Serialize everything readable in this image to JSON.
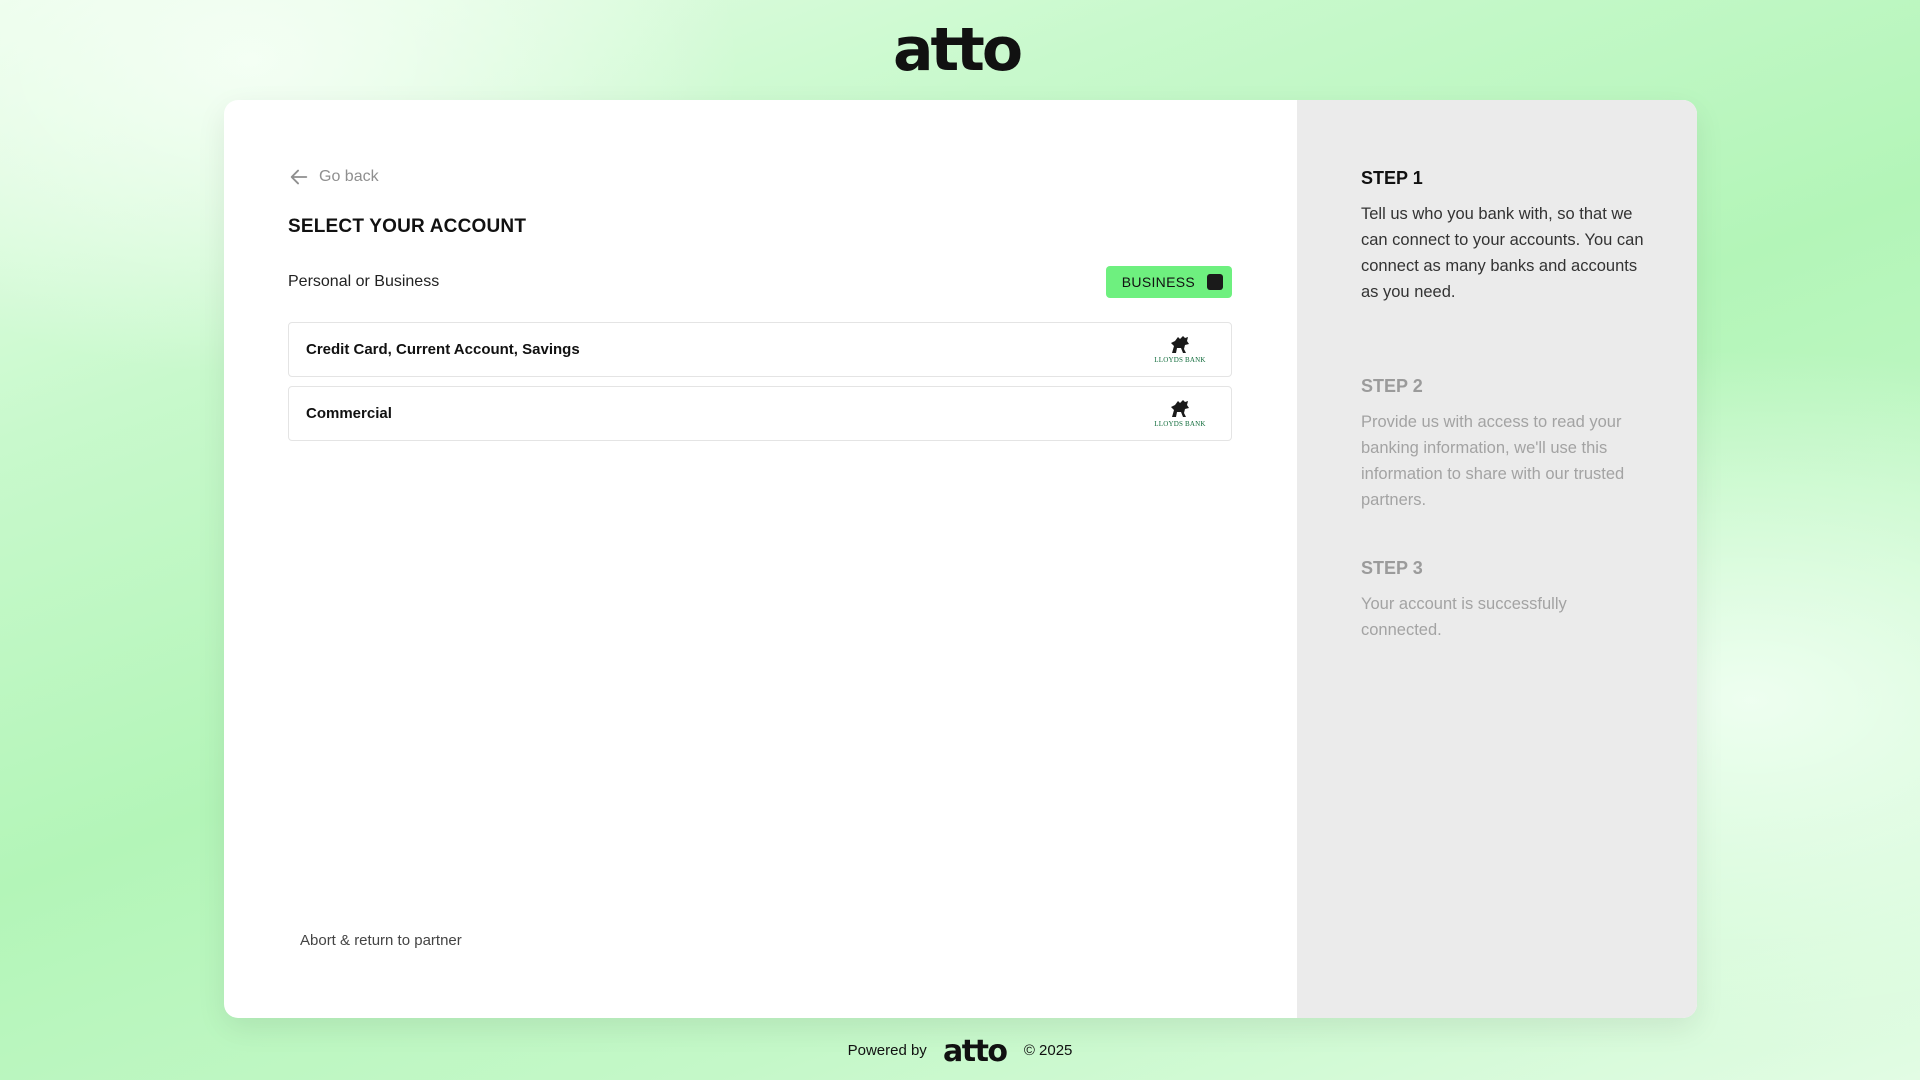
{
  "brand": {
    "name": "atto",
    "accent": "#6ef07f",
    "text_color": "#111111"
  },
  "nav": {
    "go_back_label": "Go back",
    "back_icon": "arrow-left-icon"
  },
  "page": {
    "title": "SELECT YOUR ACCOUNT",
    "account_type_label": "Personal or Business",
    "account_type_value": "BUSINESS"
  },
  "accounts": [
    {
      "name": "Credit Card, Current Account, Savings",
      "bank": "LLOYDS BANK"
    },
    {
      "name": "Commercial",
      "bank": "LLOYDS BANK"
    }
  ],
  "abort_label": "Abort & return to partner",
  "steps": [
    {
      "title": "STEP 1",
      "text": "Tell us who you bank with, so that we can connect to your accounts. You can connect as many banks and accounts as you need.",
      "active": true
    },
    {
      "title": "STEP 2",
      "text": "Provide us with access to read your banking information, we'll use this information to share with our trusted partners.",
      "active": false
    },
    {
      "title": "STEP 3",
      "text": "Your account is successfully connected.",
      "active": false
    }
  ],
  "footer": {
    "powered_by": "Powered by",
    "copyright": "© 2025"
  }
}
